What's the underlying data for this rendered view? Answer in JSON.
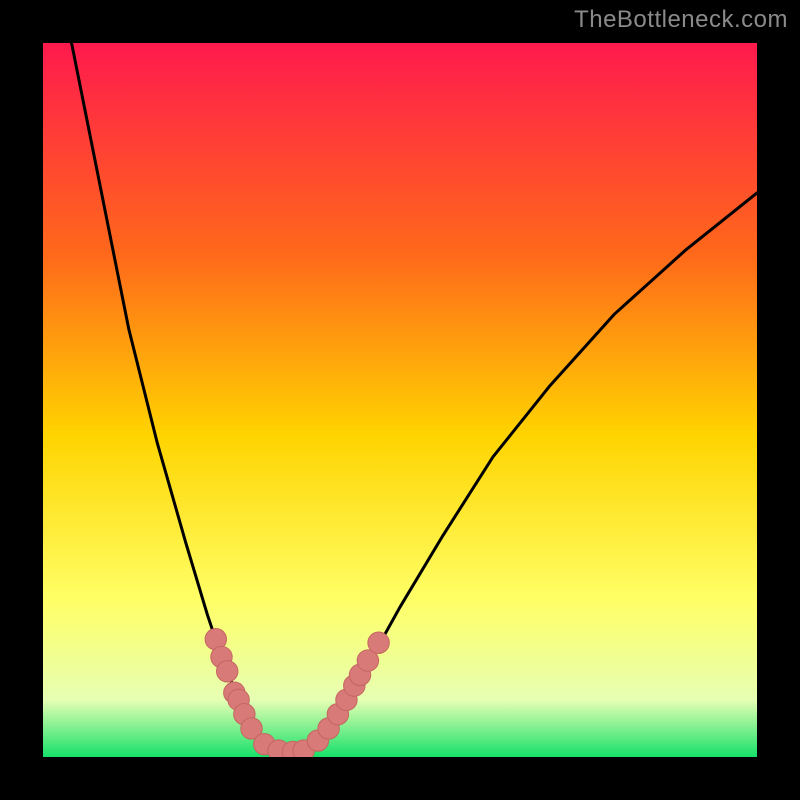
{
  "watermark": "TheBottleneck.com",
  "colors": {
    "frame": "#000000",
    "gradient_top": "#ff1a4d",
    "gradient_mid1": "#ff6a1a",
    "gradient_mid2": "#ffd400",
    "gradient_mid3": "#ffff66",
    "gradient_mid4": "#e6ffb3",
    "gradient_bottom": "#16e06a",
    "curve": "#000000",
    "marker_fill": "#d77a78",
    "marker_stroke": "#c56560"
  },
  "chart_data": {
    "type": "line",
    "title": "",
    "xlabel": "",
    "ylabel": "",
    "xlim": [
      0,
      100
    ],
    "ylim": [
      0,
      100
    ],
    "notes": "V-shaped bottleneck curve overlaid on vertical red→yellow→green gradient; minimum of curve sits at bottom (green band). Markers cluster along both branches near the minimum.",
    "series": [
      {
        "name": "bottleneck-curve",
        "points": [
          {
            "x": 4,
            "y": 100
          },
          {
            "x": 8,
            "y": 80
          },
          {
            "x": 12,
            "y": 60
          },
          {
            "x": 16,
            "y": 44
          },
          {
            "x": 20,
            "y": 30
          },
          {
            "x": 23,
            "y": 20
          },
          {
            "x": 25,
            "y": 14
          },
          {
            "x": 27,
            "y": 9
          },
          {
            "x": 29,
            "y": 5
          },
          {
            "x": 31,
            "y": 2.5
          },
          {
            "x": 33,
            "y": 1.2
          },
          {
            "x": 35,
            "y": 0.7
          },
          {
            "x": 37,
            "y": 1.2
          },
          {
            "x": 39,
            "y": 3
          },
          {
            "x": 42,
            "y": 7
          },
          {
            "x": 45,
            "y": 12
          },
          {
            "x": 50,
            "y": 21
          },
          {
            "x": 56,
            "y": 31
          },
          {
            "x": 63,
            "y": 42
          },
          {
            "x": 71,
            "y": 52
          },
          {
            "x": 80,
            "y": 62
          },
          {
            "x": 90,
            "y": 71
          },
          {
            "x": 100,
            "y": 79
          }
        ]
      }
    ],
    "markers": [
      {
        "x": 24.2,
        "y": 16.5
      },
      {
        "x": 25.0,
        "y": 14.0
      },
      {
        "x": 25.8,
        "y": 12.0
      },
      {
        "x": 26.8,
        "y": 9.0
      },
      {
        "x": 27.4,
        "y": 8.0
      },
      {
        "x": 28.2,
        "y": 6.0
      },
      {
        "x": 29.2,
        "y": 4.0
      },
      {
        "x": 31.0,
        "y": 1.8
      },
      {
        "x": 33.0,
        "y": 0.9
      },
      {
        "x": 35.0,
        "y": 0.7
      },
      {
        "x": 36.5,
        "y": 0.9
      },
      {
        "x": 38.5,
        "y": 2.3
      },
      {
        "x": 40.0,
        "y": 4.0
      },
      {
        "x": 41.3,
        "y": 6.0
      },
      {
        "x": 42.5,
        "y": 8.0
      },
      {
        "x": 43.6,
        "y": 10.0
      },
      {
        "x": 44.4,
        "y": 11.5
      },
      {
        "x": 45.5,
        "y": 13.5
      },
      {
        "x": 47.0,
        "y": 16.0
      }
    ],
    "marker_radius_pct": 1.5
  }
}
